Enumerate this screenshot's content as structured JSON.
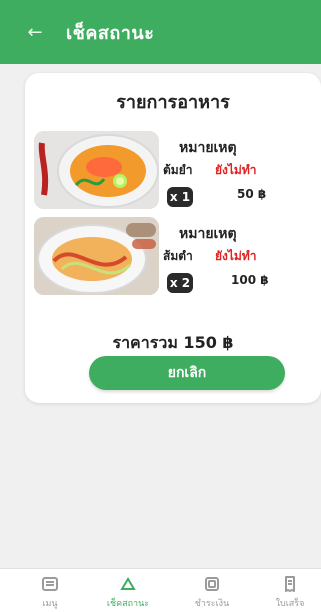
{
  "header": {
    "title": "เช็คสถานะ",
    "back_icon": "arrow-left-icon"
  },
  "card": {
    "title": "รายการอาหาร",
    "items": [
      {
        "note_label": "หมายเหตุ",
        "dish_name": "ต้มยำ",
        "status": "ยังไม่ทำ",
        "quantity": "x 1",
        "price": "50 ฿"
      },
      {
        "note_label": "หมายเหตุ",
        "dish_name": "ส้มตำ",
        "status": "ยังไม่ทำ",
        "quantity": "x 2",
        "price": "100 ฿"
      }
    ],
    "total": "ราคารวม 150 ฿",
    "cancel_label": "ยกเลิก"
  },
  "bottom_nav": {
    "items": [
      {
        "label": "เมนู",
        "icon": "menu-icon",
        "active": false
      },
      {
        "label": "เช็คสถานะ",
        "icon": "status-icon",
        "active": true
      },
      {
        "label": "ชำระเงิน",
        "icon": "payment-icon",
        "active": false
      },
      {
        "label": "ใบเสร็จ",
        "icon": "receipt-icon",
        "active": false
      }
    ]
  },
  "colors": {
    "primary": "#3fad5f",
    "status_red": "#e02222"
  }
}
